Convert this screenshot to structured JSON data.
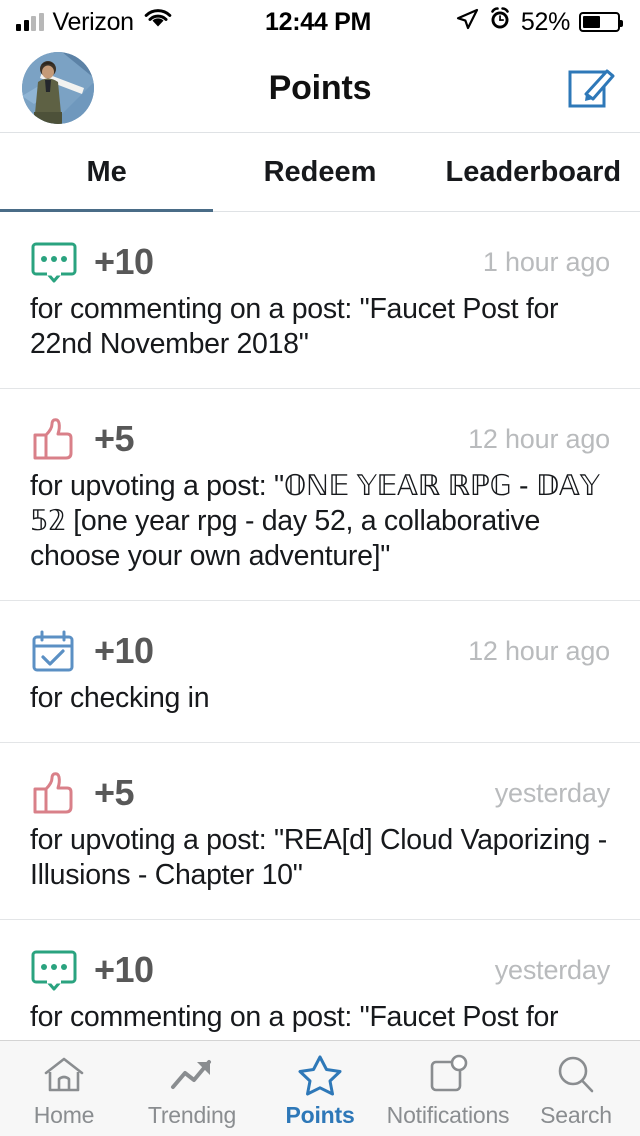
{
  "statusbar": {
    "carrier": "Verizon",
    "time": "12:44 PM",
    "battery_pct": "52%",
    "icons": [
      "signal-bars-icon",
      "wifi-icon",
      "location-arrow-icon",
      "alarm-clock-icon",
      "battery-icon"
    ]
  },
  "header": {
    "title": "Points",
    "avatar_name": "user-avatar",
    "compose_icon": "compose-pencil-icon",
    "accent": "#2e78b8"
  },
  "tabs": {
    "items": [
      {
        "label": "Me",
        "active": true
      },
      {
        "label": "Redeem",
        "active": false
      },
      {
        "label": "Leaderboard",
        "active": false
      }
    ],
    "underline_color": "#4a6c87"
  },
  "list": {
    "items": [
      {
        "icon": "comment-bubble-icon",
        "icon_color": "#2aa37f",
        "points": "+10",
        "time": "1 hour ago",
        "description": "for commenting on a post: \"Faucet Post for 22nd November 2018\""
      },
      {
        "icon": "thumbs-up-icon",
        "icon_color": "#d98089",
        "points": "+5",
        "time": "12 hour ago",
        "description": "for upvoting a post: \"𝕆ℕ𝔼 𝕐𝔼𝔸ℝ ℝℙ𝔾 - 𝔻𝔸𝕐 𝟝𝟚 [one year rpg - day 52, a collaborative choose your own adventure]\""
      },
      {
        "icon": "calendar-check-icon",
        "icon_color": "#5b90c4",
        "points": "+10",
        "time": "12 hour ago",
        "description": "for checking in"
      },
      {
        "icon": "thumbs-up-icon",
        "icon_color": "#d98089",
        "points": "+5",
        "time": "yesterday",
        "description": "for upvoting a post: \"REA[d] Cloud Vaporizing - Illusions -  Chapter 10\""
      },
      {
        "icon": "comment-bubble-icon",
        "icon_color": "#2aa37f",
        "points": "+10",
        "time": "yesterday",
        "description": "for commenting on a post: \"Faucet Post for"
      }
    ]
  },
  "tabbar": {
    "items": [
      {
        "label": "Home",
        "icon": "home-icon",
        "active": false
      },
      {
        "label": "Trending",
        "icon": "trending-arrow-icon",
        "active": false
      },
      {
        "label": "Points",
        "icon": "star-icon",
        "active": true
      },
      {
        "label": "Notifications",
        "icon": "notifications-badge-icon",
        "active": false
      },
      {
        "label": "Search",
        "icon": "search-icon",
        "active": false
      }
    ],
    "active_color": "#2e78b8",
    "inactive_color": "#8a8d90"
  }
}
